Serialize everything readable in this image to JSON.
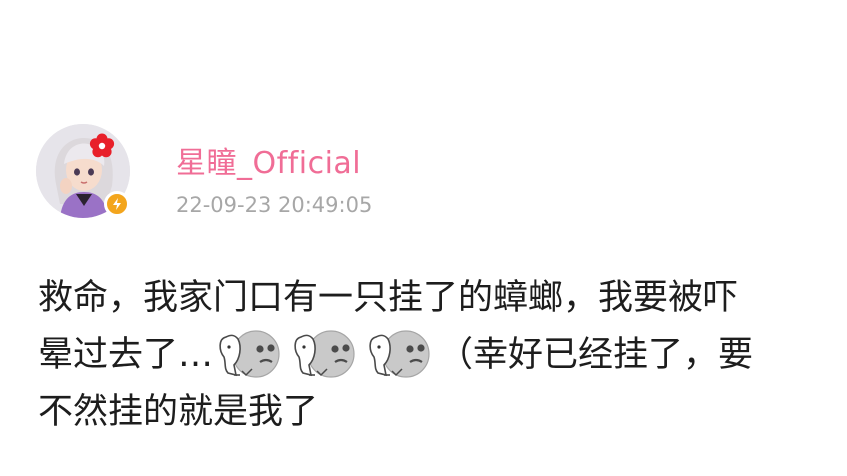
{
  "post": {
    "author": "星瞳_Official",
    "timestamp": "22-09-23 20:49:05",
    "line1": "救命，我家门口有一只挂了的蟑螂，我要被吓",
    "line2_before": "晕过去了…",
    "line2_after": "（幸好已经挂了，要",
    "line3": "不然挂的就是我了",
    "emojis": [
      "ghost-emoji",
      "ghost-emoji",
      "ghost-emoji"
    ]
  },
  "colors": {
    "author": "#f06d96",
    "timestamp": "#a7a7a7",
    "text": "#1d1d1d",
    "badge": "#f3a51d"
  },
  "icons": {
    "avatar": "avatar-girl-icon",
    "badge": "lightning-badge-icon",
    "emoji": "ghost-emoji-icon"
  }
}
